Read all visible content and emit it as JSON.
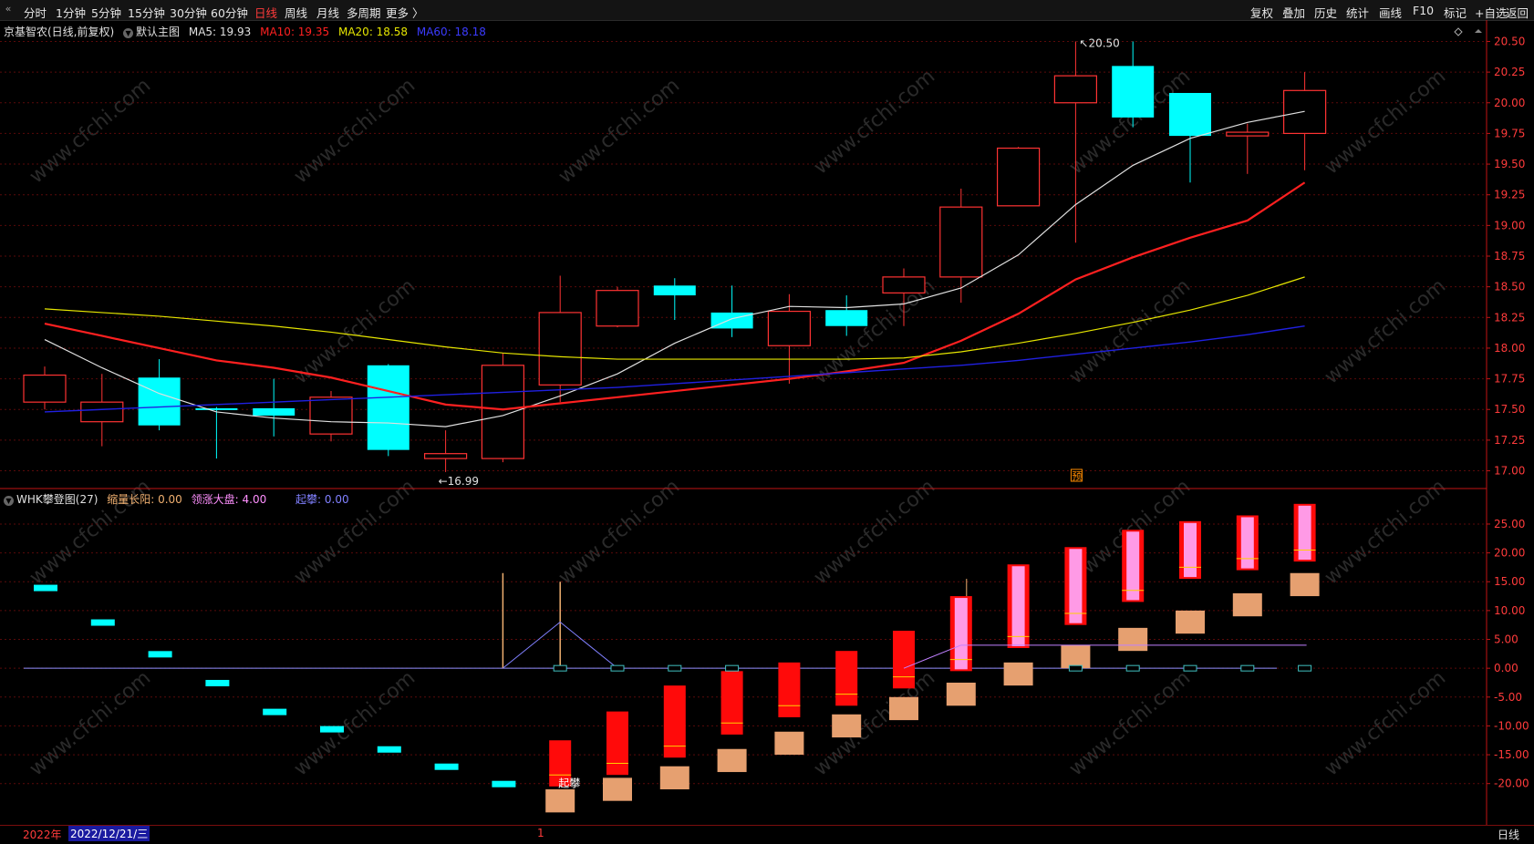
{
  "toolbar": {
    "left": [
      "分时",
      "1分钟",
      "5分钟",
      "15分钟",
      "30分钟",
      "60分钟",
      "日线",
      "周线",
      "月线",
      "多周期",
      "更多 〉"
    ],
    "active": "日线",
    "right": [
      "复权",
      "叠加",
      "历史",
      "统计",
      "画线",
      "F10",
      "标记",
      "+自选",
      "返回"
    ]
  },
  "main_legend": {
    "title": "京基智农(日线,前复权)",
    "indicator": "默认主图",
    "ma5": "MA5: 19.93",
    "ma10": "MA10: 19.35",
    "ma20": "MA20: 18.58",
    "ma60": "MA60: 18.18"
  },
  "sub_legend": {
    "title": "WHK攀登图(27)",
    "a": "缩量长阳: 0.00",
    "b": "领涨大盘: 4.00",
    "c": "起攀: 0.00"
  },
  "annotations": {
    "high": "20.50",
    "low": "16.99",
    "yu": "预",
    "qipan": "起攀"
  },
  "footer": {
    "year": "2022年",
    "date": "2022/12/21/三",
    "tick": "1",
    "period": "日线"
  },
  "watermark": "www.cfchi.com",
  "colors": {
    "up": "#ff3333",
    "down": "#00ffff",
    "ma5": "#e0e0e0",
    "ma10": "#ff2020",
    "ma20": "#e6e600",
    "ma60": "#2020e0",
    "axis": "#c21414",
    "grid": "#5a0a0a"
  },
  "chart_data": [
    {
      "type": "candlestick",
      "title": "京基智农(日线,前复权)",
      "y_ticks": [
        "20.50",
        "20.25",
        "20.00",
        "19.75",
        "19.50",
        "19.25",
        "19.00",
        "18.75",
        "18.50",
        "18.25",
        "18.00",
        "17.75",
        "17.50",
        "17.25",
        "17.00"
      ],
      "ylim": [
        16.9,
        20.6
      ],
      "candles": [
        {
          "o": 17.56,
          "c": 17.78,
          "h": 17.85,
          "l": 17.5
        },
        {
          "o": 17.4,
          "c": 17.56,
          "h": 17.79,
          "l": 17.2
        },
        {
          "o": 17.76,
          "c": 17.37,
          "h": 17.91,
          "l": 17.33
        },
        {
          "o": 17.51,
          "c": 17.5,
          "h": 17.52,
          "l": 17.1
        },
        {
          "o": 17.51,
          "c": 17.45,
          "h": 17.75,
          "l": 17.28
        },
        {
          "o": 17.3,
          "c": 17.6,
          "h": 17.65,
          "l": 17.24
        },
        {
          "o": 17.86,
          "c": 17.17,
          "h": 17.87,
          "l": 17.12
        },
        {
          "o": 17.1,
          "c": 17.14,
          "h": 17.33,
          "l": 16.99
        },
        {
          "o": 17.1,
          "c": 17.86,
          "h": 17.96,
          "l": 17.07
        },
        {
          "o": 17.7,
          "c": 18.29,
          "h": 18.59,
          "l": 17.56
        },
        {
          "o": 18.18,
          "c": 18.47,
          "h": 18.5,
          "l": 18.17
        },
        {
          "o": 18.51,
          "c": 18.43,
          "h": 18.57,
          "l": 18.23
        },
        {
          "o": 18.29,
          "c": 18.16,
          "h": 18.51,
          "l": 18.09
        },
        {
          "o": 18.02,
          "c": 18.3,
          "h": 18.44,
          "l": 17.71
        },
        {
          "o": 18.31,
          "c": 18.18,
          "h": 18.43,
          "l": 18.1
        },
        {
          "o": 18.45,
          "c": 18.58,
          "h": 18.65,
          "l": 18.18
        },
        {
          "o": 18.58,
          "c": 19.15,
          "h": 19.3,
          "l": 18.37
        },
        {
          "o": 19.16,
          "c": 19.63,
          "h": 19.64,
          "l": 19.16
        },
        {
          "o": 20.0,
          "c": 20.22,
          "h": 20.5,
          "l": 18.86
        },
        {
          "o": 20.3,
          "c": 19.88,
          "h": 20.5,
          "l": 19.8
        },
        {
          "o": 20.08,
          "c": 19.73,
          "h": 20.08,
          "l": 19.35
        },
        {
          "o": 19.73,
          "c": 19.76,
          "h": 19.83,
          "l": 19.42
        },
        {
          "o": 19.75,
          "c": 20.1,
          "h": 20.25,
          "l": 19.45
        }
      ],
      "series": [
        {
          "name": "MA5",
          "values": [
            18.07,
            17.84,
            17.63,
            17.48,
            17.43,
            17.4,
            17.39,
            17.36,
            17.45,
            17.61,
            17.79,
            18.04,
            18.24,
            18.34,
            18.33,
            18.36,
            18.49,
            18.76,
            19.17,
            19.49,
            19.71,
            19.84,
            19.93
          ]
        },
        {
          "name": "MA10",
          "values": [
            18.2,
            18.1,
            18.0,
            17.9,
            17.84,
            17.76,
            17.65,
            17.54,
            17.5,
            17.55,
            17.6,
            17.65,
            17.7,
            17.75,
            17.81,
            17.88,
            18.06,
            18.28,
            18.56,
            18.74,
            18.9,
            19.04,
            19.35
          ]
        },
        {
          "name": "MA20",
          "values": [
            18.32,
            18.29,
            18.26,
            18.22,
            18.18,
            18.13,
            18.07,
            18.01,
            17.96,
            17.93,
            17.91,
            17.91,
            17.91,
            17.91,
            17.91,
            17.92,
            17.97,
            18.04,
            18.12,
            18.21,
            18.31,
            18.43,
            18.58
          ]
        },
        {
          "name": "MA60",
          "values": [
            17.48,
            17.5,
            17.52,
            17.54,
            17.56,
            17.58,
            17.6,
            17.62,
            17.64,
            17.66,
            17.68,
            17.71,
            17.74,
            17.77,
            17.8,
            17.83,
            17.86,
            17.9,
            17.95,
            18.0,
            18.05,
            18.11,
            18.18
          ]
        }
      ]
    },
    {
      "type": "bar",
      "title": "WHK攀登图(27)",
      "y_ticks": [
        "25.00",
        "20.00",
        "15.00",
        "10.00",
        "5.00",
        "0.00",
        "-5.00",
        "-10.00",
        "-15.00",
        "-20.00"
      ],
      "ylim": [
        -27,
        31
      ],
      "cyan_marks": [
        14,
        8,
        2.5,
        -2.5,
        -7.5,
        -10.5,
        -14,
        -17,
        -20
      ],
      "red_bars": [
        {
          "top": -12.5,
          "bottom": -20.5
        },
        {
          "top": -7.5,
          "bottom": -18.5
        },
        {
          "top": -3,
          "bottom": -15.5
        },
        {
          "top": -0.5,
          "bottom": -11.5
        },
        {
          "top": 1,
          "bottom": -8.5
        },
        {
          "top": 3,
          "bottom": -6.5
        },
        {
          "top": 6.5,
          "bottom": -3.5
        },
        {
          "top": 12.5,
          "bottom": -0.5
        },
        {
          "top": 18,
          "bottom": 3.5
        },
        {
          "top": 21,
          "bottom": 7.5
        },
        {
          "top": 24,
          "bottom": 11.5
        },
        {
          "top": 25.5,
          "bottom": 15.5
        },
        {
          "top": 26.5,
          "bottom": 17
        },
        {
          "top": 28.5,
          "bottom": 18.5
        }
      ],
      "orange_boxes": [
        -23,
        -21,
        -19,
        -16,
        -13,
        -10,
        -7,
        -4.5,
        -1,
        2,
        5,
        8,
        11,
        14.5
      ],
      "pink_start": 7
    }
  ]
}
